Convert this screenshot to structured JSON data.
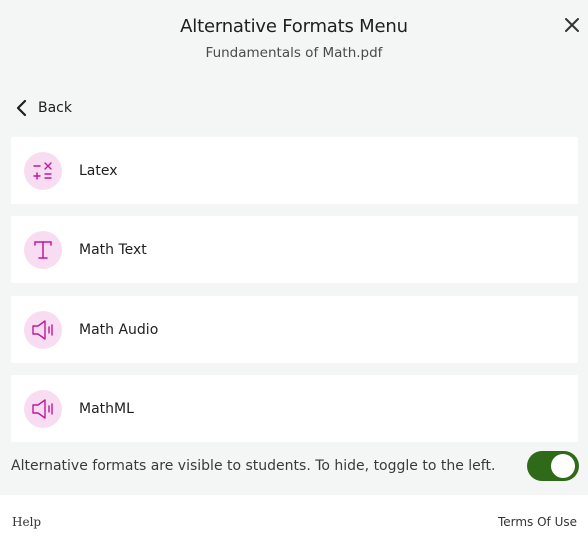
{
  "header": {
    "title": "Alternative Formats Menu",
    "subtitle": "Fundamentals of Math.pdf",
    "close_icon": "close-icon"
  },
  "nav": {
    "back_label": "Back",
    "back_icon": "chevron-left-icon"
  },
  "formats": [
    {
      "label": "Latex",
      "icon": "math-operators-icon"
    },
    {
      "label": "Math Text",
      "icon": "text-t-icon"
    },
    {
      "label": "Math Audio",
      "icon": "speaker-icon"
    },
    {
      "label": "MathML",
      "icon": "speaker-icon"
    }
  ],
  "visibility": {
    "text": "Alternative formats are visible to students. To hide, toggle to the left.",
    "toggle_on": true
  },
  "footer": {
    "help_label": "Help",
    "terms_label": "Terms Of Use"
  },
  "colors": {
    "icon_accent": "#c2189a",
    "icon_bg": "#f8ddf2",
    "toggle_on": "#2f6a18",
    "page_bg": "#f4f5f5"
  }
}
